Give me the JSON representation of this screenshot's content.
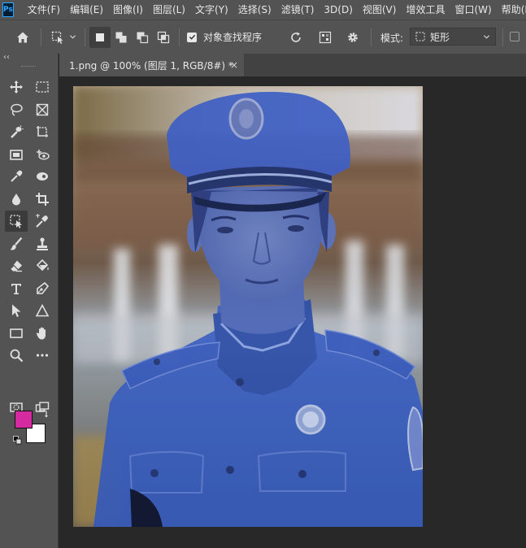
{
  "app": {
    "logo_text": "Ps"
  },
  "menu": [
    {
      "label": "文件(F)"
    },
    {
      "label": "编辑(E)"
    },
    {
      "label": "图像(I)"
    },
    {
      "label": "图层(L)"
    },
    {
      "label": "文字(Y)"
    },
    {
      "label": "选择(S)"
    },
    {
      "label": "滤镜(T)"
    },
    {
      "label": "3D(D)"
    },
    {
      "label": "视图(V)"
    },
    {
      "label": "增效工具"
    },
    {
      "label": "窗口(W)"
    },
    {
      "label": "帮助(H)"
    }
  ],
  "options_bar": {
    "object_finder_label": "对象查找程序",
    "object_finder_checked": true,
    "mode_label": "模式:",
    "mode_value": "矩形"
  },
  "toolbar": {
    "collapse_glyph": "‹‹",
    "active_tool": "object-selection-tool"
  },
  "colors": {
    "foreground": "#d62ba0",
    "background": "#ffffff",
    "selection_overlay": "#2f5fc9"
  },
  "document": {
    "tab_title": "1.png @ 100% (图层 1, RGB/8#) *",
    "close_glyph": "×"
  }
}
